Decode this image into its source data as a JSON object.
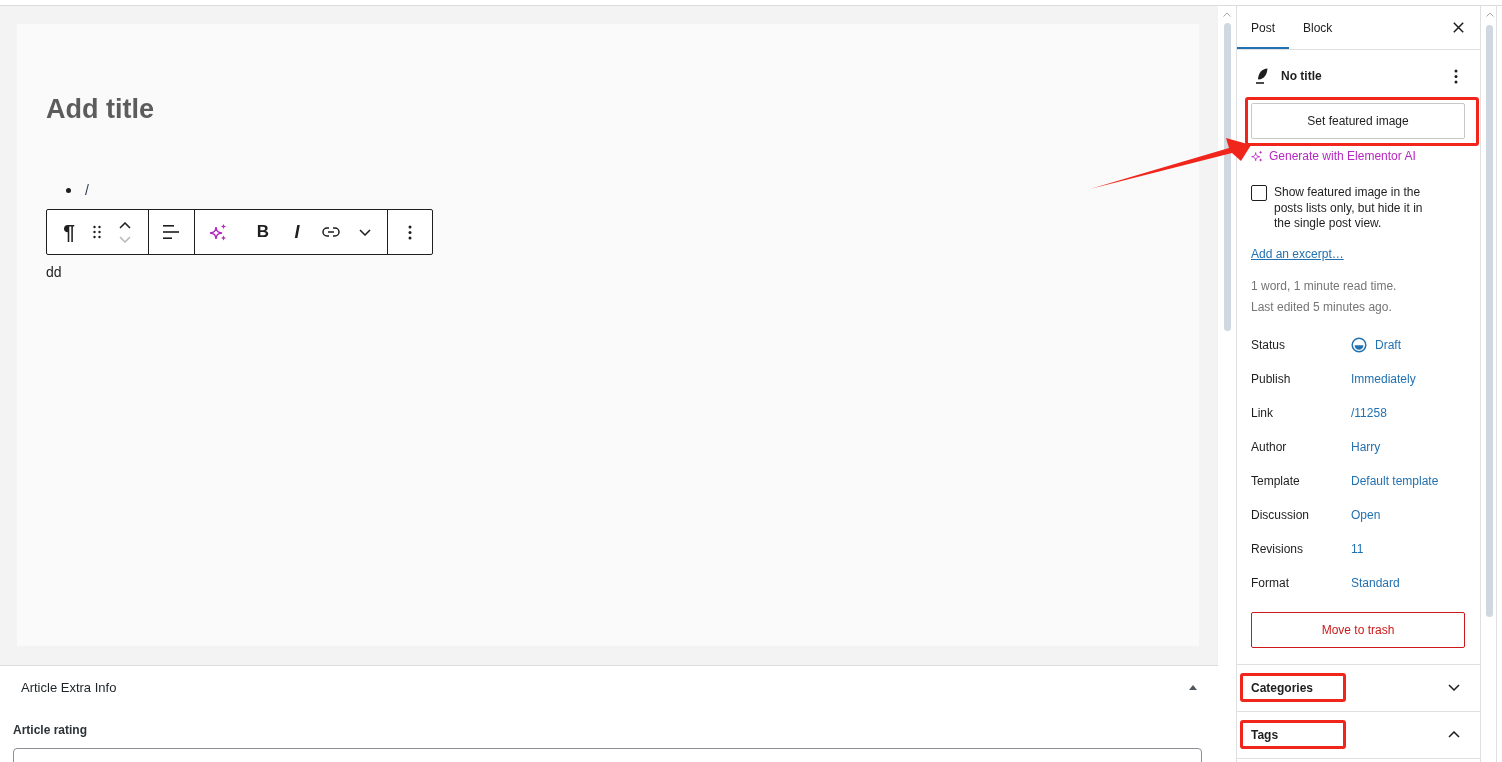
{
  "editor": {
    "title": {
      "placeholder": "Add title"
    },
    "list_items": [
      "/"
    ],
    "block_toolbar": {
      "groups": [
        {
          "items": [
            {
              "kind": "glyph",
              "label": "¶"
            },
            {
              "kind": "drag"
            },
            {
              "kind": "movers",
              "buttons": [
                {
                  "disabled": false
                },
                {
                  "disabled": true
                }
              ]
            }
          ]
        },
        {
          "items": [
            {
              "kind": "align"
            }
          ]
        },
        {
          "items": [
            {
              "kind": "ai"
            },
            {
              "kind": "bold",
              "label": "B"
            },
            {
              "kind": "italic",
              "label": "I"
            },
            {
              "kind": "link"
            },
            {
              "kind": "more"
            }
          ]
        },
        {
          "items": [
            {
              "kind": "options"
            }
          ]
        }
      ]
    },
    "paragraph": "dd"
  },
  "meta_box": {
    "title": "Article Extra Info",
    "expanded": true,
    "fields": [
      {
        "label": "Article rating"
      }
    ]
  },
  "sidebar": {
    "tabs": [
      {
        "label": "Post",
        "selected": true
      },
      {
        "label": "Block",
        "selected": false
      }
    ],
    "post_title": "No title",
    "featured_image": {
      "button": "Set featured image",
      "highlighted": true,
      "arrow": true
    },
    "ai_link": "Generate with Elementor AI",
    "featured_option": {
      "label": "Show featured image in the posts lists only, but hide it in the single post view.",
      "checked": false
    },
    "excerpt_link": "Add an excerpt…",
    "stats": [
      "1 word, 1 minute read time.",
      "Last edited 5 minutes ago."
    ],
    "properties": [
      {
        "label": "Status",
        "value": "Draft",
        "kind": "status"
      },
      {
        "label": "Publish",
        "value": "Immediately",
        "kind": "link"
      },
      {
        "label": "Link",
        "value": "/11258",
        "kind": "link"
      },
      {
        "label": "Author",
        "value": "Harry",
        "kind": "link"
      },
      {
        "label": "Template",
        "value": "Default template",
        "kind": "link"
      },
      {
        "label": "Discussion",
        "value": "Open",
        "kind": "link"
      },
      {
        "label": "Revisions",
        "value": "11",
        "kind": "link"
      },
      {
        "label": "Format",
        "value": "Standard",
        "kind": "link"
      }
    ],
    "trash_button": "Move to trash",
    "panels": [
      {
        "title": "Categories",
        "expanded": false,
        "highlighted": true
      },
      {
        "title": "Tags",
        "expanded": true,
        "highlighted": true
      }
    ]
  }
}
